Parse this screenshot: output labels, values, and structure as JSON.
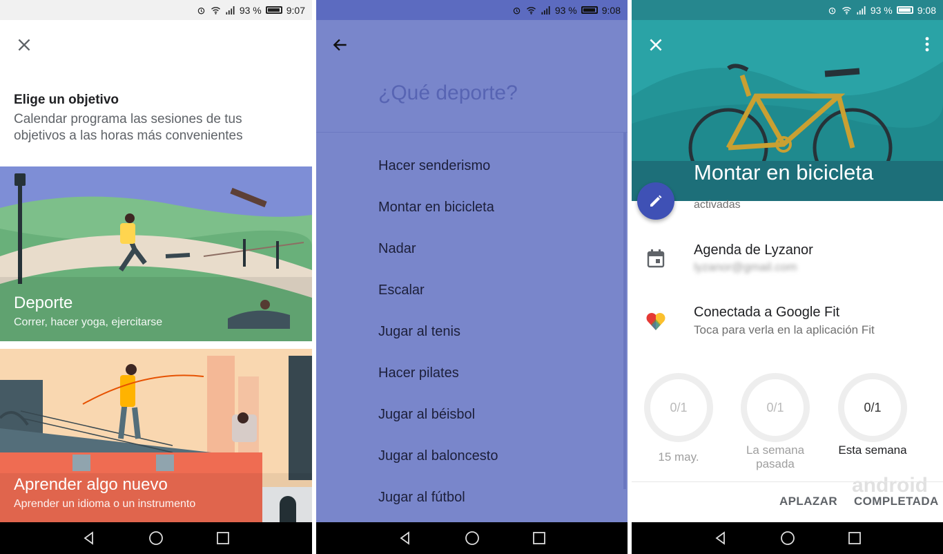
{
  "statusbars": [
    {
      "signal": "93 %",
      "time": "9:07"
    },
    {
      "signal": "93 %",
      "time": "9:08"
    },
    {
      "signal": "93 %",
      "time": "9:08"
    }
  ],
  "goal_screen": {
    "title": "Elige un objetivo",
    "subtitle": "Calendar programa las sesiones de tus objetivos a las horas más convenientes",
    "cards": [
      {
        "title": "Deporte",
        "subtitle": "Correr, hacer yoga, ejercitarse"
      },
      {
        "title": "Aprender algo nuevo",
        "subtitle": "Aprender un idioma o un instrumento"
      }
    ]
  },
  "sport_screen": {
    "question": "¿Qué deporte?",
    "items": [
      "Hacer senderismo",
      "Montar en bicicleta",
      "Nadar",
      "Escalar",
      "Jugar al tenis",
      "Hacer pilates",
      "Jugar al béisbol",
      "Jugar al baloncesto",
      "Jugar al fútbol"
    ]
  },
  "detail_screen": {
    "title": "Montar en bicicleta",
    "activated_text": "activadas",
    "calendar_title": "Agenda de Lyzanor",
    "calendar_account": "lyzanor@gmail.com",
    "fit_title": "Conectada a Google Fit",
    "fit_subtitle": "Toca para verla en la aplicación Fit",
    "progress": [
      {
        "value": "0/1",
        "label": "15 may.",
        "emphasis": false
      },
      {
        "value": "0/1",
        "label": "La semana pasada",
        "emphasis": false
      },
      {
        "value": "0/1",
        "label": "Esta semana",
        "emphasis": true
      }
    ],
    "actions": {
      "postpone": "APLAZAR",
      "complete": "COMPLETADA"
    },
    "watermark": "android"
  },
  "colors": {
    "primary_indigo": "#7986cb",
    "fab_blue": "#3f51b5",
    "hero_teal": "#2aa3a6"
  },
  "icons": [
    "close-icon",
    "back-arrow-icon",
    "more-vert-icon",
    "edit-icon",
    "calendar-icon",
    "google-fit-heart-icon",
    "nav-back-icon",
    "nav-home-icon",
    "nav-recents-icon"
  ]
}
